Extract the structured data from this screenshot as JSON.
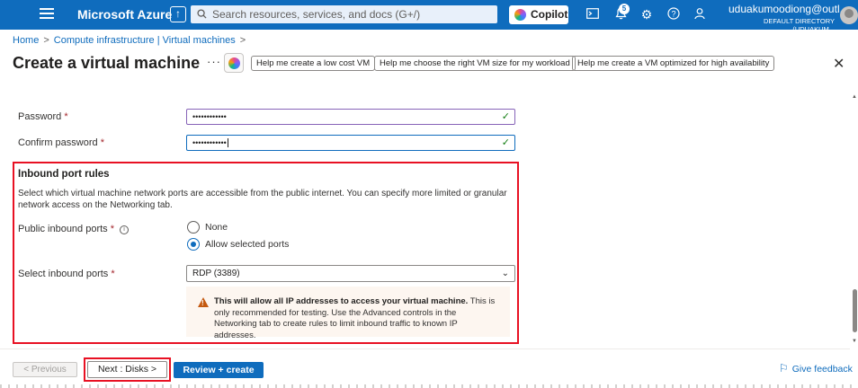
{
  "topbar": {
    "brand": "Microsoft Azure",
    "search_placeholder": "Search resources, services, and docs (G+/)",
    "copilot_label": "Copilot",
    "notification_count": "5",
    "account_email": "uduakumoodiong@outl...",
    "account_directory": "DEFAULT DIRECTORY (UDUAKUM..."
  },
  "breadcrumb": [
    "Home",
    "Compute infrastructure | Virtual machines"
  ],
  "header": {
    "title": "Create a virtual machine",
    "more": "···",
    "chips": [
      "Help me create a low cost VM",
      "Help me choose the right VM size for my workload",
      "Help me create a VM optimized for high availability"
    ]
  },
  "form": {
    "password_label": "Password",
    "password_value": "••••••••••••",
    "confirm_label": "Confirm password",
    "confirm_value": "••••••••••••",
    "required_mark": "*",
    "check": "✓"
  },
  "inbound": {
    "title": "Inbound port rules",
    "description": "Select which virtual machine network ports are accessible from the public internet. You can specify more limited or granular network access on the Networking tab.",
    "public_ports_label": "Public inbound ports",
    "options": [
      "None",
      "Allow selected ports"
    ],
    "selected_option": "Allow selected ports",
    "select_ports_label": "Select inbound ports",
    "select_value": "RDP (3389)",
    "warning_bold": "This will allow all IP addresses to access your virtual machine.",
    "warning_rest": " This is only recommended for testing.  Use the Advanced controls in the Networking tab to create rules to limit inbound traffic to known IP addresses."
  },
  "footer": {
    "previous": "< Previous",
    "next": "Next : Disks >",
    "review": "Review + create",
    "feedback": "Give feedback"
  },
  "colors": {
    "azure_blue": "#0f6cbd",
    "highlight_red": "#e81123",
    "warning_orange": "#c4590f",
    "success_green": "#107c10"
  }
}
